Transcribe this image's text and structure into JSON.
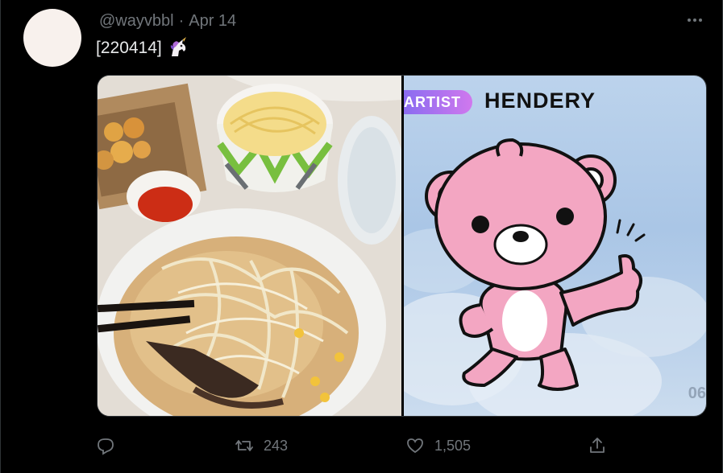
{
  "tweet": {
    "handle": "@wayvbbl",
    "separator": "·",
    "date": "Apr 14",
    "text": "[220414]",
    "emoji_icon": "unicorn-icon"
  },
  "media": {
    "left_image": "ramen-food-photo",
    "right_card": {
      "tag": "ARTIST",
      "name": "HENDERY",
      "page": "06",
      "character": "pink-bear-thumbs-up"
    }
  },
  "actions": {
    "reply_icon": "reply-icon",
    "retweet_icon": "retweet-icon",
    "retweet_count": "243",
    "like_icon": "heart-icon",
    "like_count": "1,505",
    "share_icon": "share-icon"
  },
  "colors": {
    "background": "#000000",
    "muted_text": "#71767b",
    "primary_text": "#e7e9ea",
    "avatar": "#f8f1ed",
    "pill_start": "#8a6cf0",
    "pill_end": "#d078ee",
    "bear_pink": "#f3a6c2"
  }
}
